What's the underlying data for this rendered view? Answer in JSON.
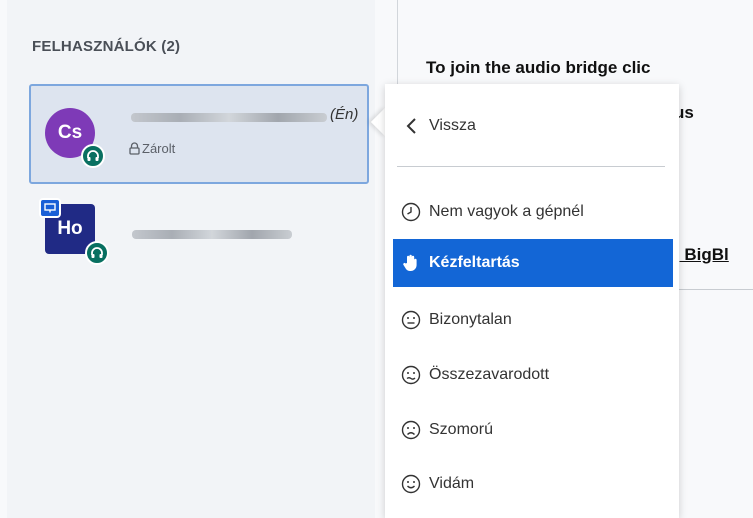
{
  "sidebar": {
    "title": "FELHASZNÁLÓK (2)",
    "users": [
      {
        "initials": "Cs",
        "you_label": "(Én)",
        "status": "Zárolt",
        "avatar_color": "#7e3ab7",
        "audio": "headset-icon"
      },
      {
        "initials": "Ho",
        "avatar_color": "#202a85",
        "audio": "headset-icon",
        "presenter": "presenter-icon"
      }
    ]
  },
  "main": {
    "line1": "To join the audio bridge clic",
    "line2": "d caus",
    "link": "; BigBl"
  },
  "menu": {
    "back": "Vissza",
    "items": [
      {
        "label": "Nem vagyok a gépnél",
        "icon": "clock-icon"
      },
      {
        "label": "Kézfeltartás",
        "icon": "hand-icon",
        "active": true
      },
      {
        "label": "Bizonytalan",
        "icon": "neutral-face-icon"
      },
      {
        "label": "Összezavarodott",
        "icon": "confused-face-icon"
      },
      {
        "label": "Szomorú",
        "icon": "sad-face-icon"
      },
      {
        "label": "Vidám",
        "icon": "happy-face-icon"
      }
    ]
  },
  "colors": {
    "accent": "#1366d6",
    "selected_bg": "#dde4ef",
    "headset": "#097061"
  }
}
